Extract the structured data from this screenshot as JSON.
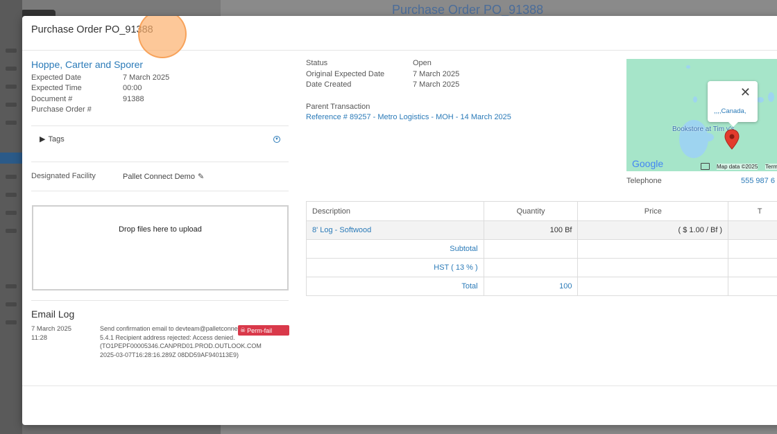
{
  "modal": {
    "title": "Purchase Order PO_91388"
  },
  "supplier": {
    "name": "Hoppe, Carter and Sporer",
    "fields": [
      {
        "label": "Expected Date",
        "value": "7 March 2025"
      },
      {
        "label": "Expected Time",
        "value": "00:00"
      },
      {
        "label": "Document #",
        "value": "91388"
      },
      {
        "label": "Purchase Order #",
        "value": ""
      }
    ]
  },
  "tags": {
    "label": "Tags"
  },
  "facility": {
    "label": "Designated Facility",
    "value": "Pallet Connect Demo"
  },
  "dropzone": {
    "text": "Drop files here to upload"
  },
  "email_log": {
    "title": "Email Log",
    "entry": {
      "date": "7 March 2025",
      "time": "11:28",
      "message": "Send confirmation email to devteam@palletconnect.com 5.4.1 Recipient address rejected: Access denied. (TO1PEPF00005346.CANPRD01.PROD.OUTLOOK.COM 2025-03-07T16:28:16.289Z 08DD59AF940113E9)",
      "badge": "Perm-fail"
    }
  },
  "status": {
    "fields": [
      {
        "label": "Status",
        "value": "Open"
      },
      {
        "label": "Original Expected Date",
        "value": "7 March 2025"
      },
      {
        "label": "Date Created",
        "value": "7 March 2025"
      }
    ],
    "parent_label": "Parent Transaction",
    "parent_link": "Reference # 89257 - Metro Logistics - MOH - 14 March 2025"
  },
  "map": {
    "popup_link": ",,,,Canada,",
    "place_label": "Bookstore at Tim  y's",
    "google": "Google",
    "attribution": "Map data ©2025",
    "terms": "Term"
  },
  "contact": {
    "tel_label": "Telephone",
    "tel_value": "555 987 6"
  },
  "table": {
    "headers": [
      "Description",
      "Quantity",
      "Price",
      "T"
    ],
    "item": {
      "description": "8' Log - Softwood",
      "quantity": "100 Bf",
      "price": "( $ 1.00 / Bf )"
    },
    "subtotal_label": "Subtotal",
    "tax_label": "HST ( 13 % )",
    "total_label": "Total",
    "total_qty": "100"
  },
  "background": {
    "panel_title": "Purchase Order PO_91388"
  },
  "colors": {
    "link": "#2a7ab8",
    "badge": "#d9394a"
  }
}
